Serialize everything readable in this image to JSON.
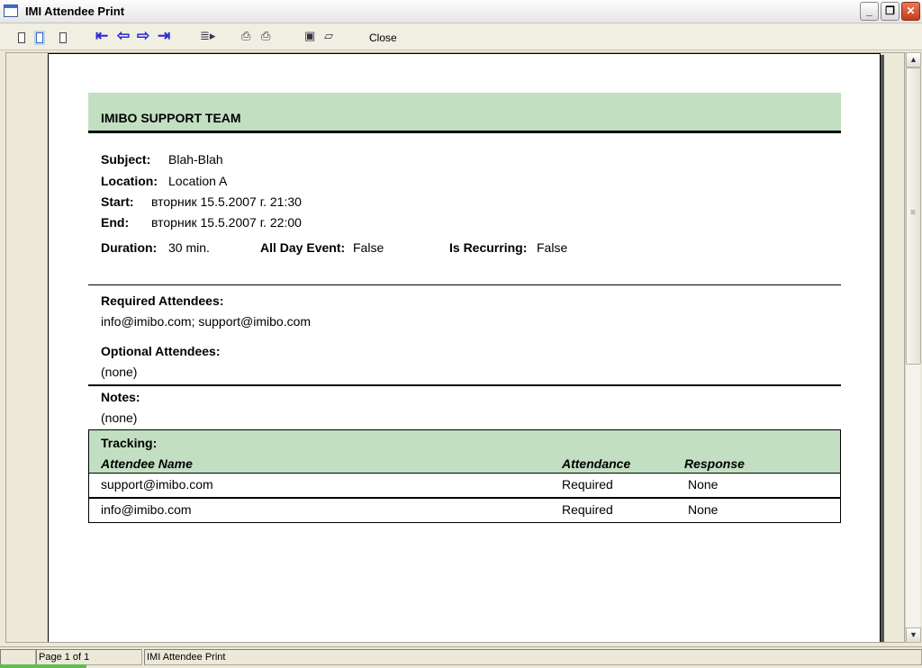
{
  "window": {
    "title": "IMI Attendee Print",
    "min_label": "_",
    "max_label": "❐",
    "close_label": "✕"
  },
  "toolbar": {
    "close_label": "Close"
  },
  "report": {
    "header": "IMIBO SUPPORT TEAM",
    "subject_label": "Subject:",
    "subject": "Blah-Blah",
    "location_label": "Location:",
    "location": "Location A",
    "start_label": "Start:",
    "start": "вторник 15.5.2007 г. 21:30",
    "end_label": "End:",
    "end": "вторник 15.5.2007 г. 22:00",
    "duration_label": "Duration:",
    "duration": "30 min.",
    "allday_label": "All Day Event:",
    "allday": "False",
    "recurring_label": "Is Recurring:",
    "recurring": "False",
    "required_label": "Required Attendees:",
    "required": "info@imibo.com;  support@imibo.com",
    "optional_label": "Optional Attendees:",
    "optional": "(none)",
    "notes_label": "Notes:",
    "notes": "(none)",
    "tracking_label": "Tracking:",
    "columns": [
      "Attendee Name",
      "Attendance",
      "Response"
    ],
    "rows": [
      {
        "name": "support@imibo.com",
        "attendance": "Required",
        "response": "None"
      },
      {
        "name": "info@imibo.com",
        "attendance": "Required",
        "response": "None"
      }
    ]
  },
  "status": {
    "page": "Page 1 of 1",
    "doc": "IMI Attendee Print"
  }
}
